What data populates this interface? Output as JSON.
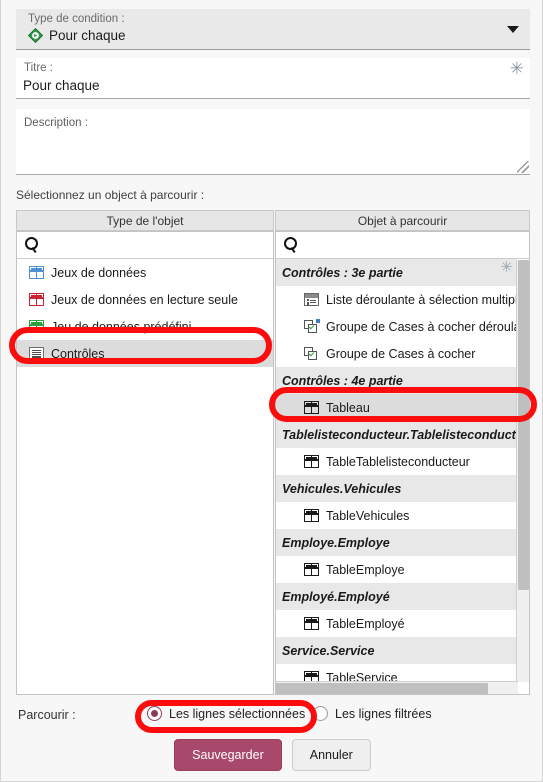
{
  "condition": {
    "label": "Type de condition :",
    "value": "Pour chaque",
    "icon": "green-diamond-icon",
    "caret": "chevron-down-icon"
  },
  "titre": {
    "label": "Titre :",
    "value": "Pour chaque",
    "placeholder": "",
    "required_marker": "✳"
  },
  "description": {
    "label": "Description :",
    "value": "",
    "placeholder": ""
  },
  "section": {
    "label": "Sélectionnez un object à parcourir :"
  },
  "left_panel": {
    "header": "Type de l'objet",
    "search": {
      "placeholder": "",
      "value": "",
      "icon": "search-icon"
    },
    "items": [
      {
        "label": "Jeux de données",
        "icon": "table-icon",
        "color": "#4f8fd4",
        "selected": false
      },
      {
        "label": "Jeux de données en lecture seule",
        "icon": "table-icon",
        "color": "#cc2233",
        "selected": false
      },
      {
        "label": "Jeu de données prédéfini",
        "icon": "table-icon",
        "color": "#2f9e3f",
        "selected": false
      },
      {
        "label": "Contrôles",
        "icon": "lines-icon",
        "color": "#4a4a4a",
        "selected": true
      }
    ]
  },
  "right_panel": {
    "header": "Objet à parcourir",
    "search": {
      "placeholder": "",
      "value": "",
      "icon": "search-icon"
    },
    "required_marker": "✳",
    "groups": [
      {
        "title": "Contrôles : 3e partie",
        "items": [
          {
            "label": "Liste déroulante à sélection multiple",
            "icon": "dropdown-list-icon",
            "selected": false
          },
          {
            "label": "Groupe de Cases à cocher déroulant",
            "icon": "checkbox-group-dropdown-icon",
            "selected": false
          },
          {
            "label": "Groupe de Cases à cocher",
            "icon": "checkbox-group-icon",
            "selected": false
          }
        ]
      },
      {
        "title": "Contrôles : 4e partie",
        "items": [
          {
            "label": "Tableau",
            "icon": "table-icon",
            "selected": true
          }
        ]
      },
      {
        "title": "Tablelisteconducteur.Tablelisteconducteur",
        "items": [
          {
            "label": "TableTablelisteconducteur",
            "icon": "table-icon",
            "selected": false
          }
        ]
      },
      {
        "title": "Vehicules.Vehicules",
        "items": [
          {
            "label": "TableVehicules",
            "icon": "table-icon",
            "selected": false
          }
        ]
      },
      {
        "title": "Employe.Employe",
        "items": [
          {
            "label": "TableEmploye",
            "icon": "table-icon",
            "selected": false
          }
        ]
      },
      {
        "title": "Employé.Employé",
        "items": [
          {
            "label": "TableEmployé",
            "icon": "table-icon",
            "selected": false
          }
        ]
      },
      {
        "title": "Service.Service",
        "items": [
          {
            "label": "TableService",
            "icon": "table-icon",
            "selected": false
          }
        ]
      }
    ]
  },
  "parcourir": {
    "label": "Parcourir :",
    "options": [
      {
        "label": "Les lignes sélectionnées",
        "selected": true
      },
      {
        "label": "Les lignes filtrées",
        "selected": false
      }
    ]
  },
  "buttons": {
    "save": "Sauvegarder",
    "cancel": "Annuler"
  },
  "colors": {
    "accent": "#a8486a",
    "annotation": "#fc0d0d",
    "selection": "#dcdcdc",
    "group_header": "#e8e8e8"
  }
}
